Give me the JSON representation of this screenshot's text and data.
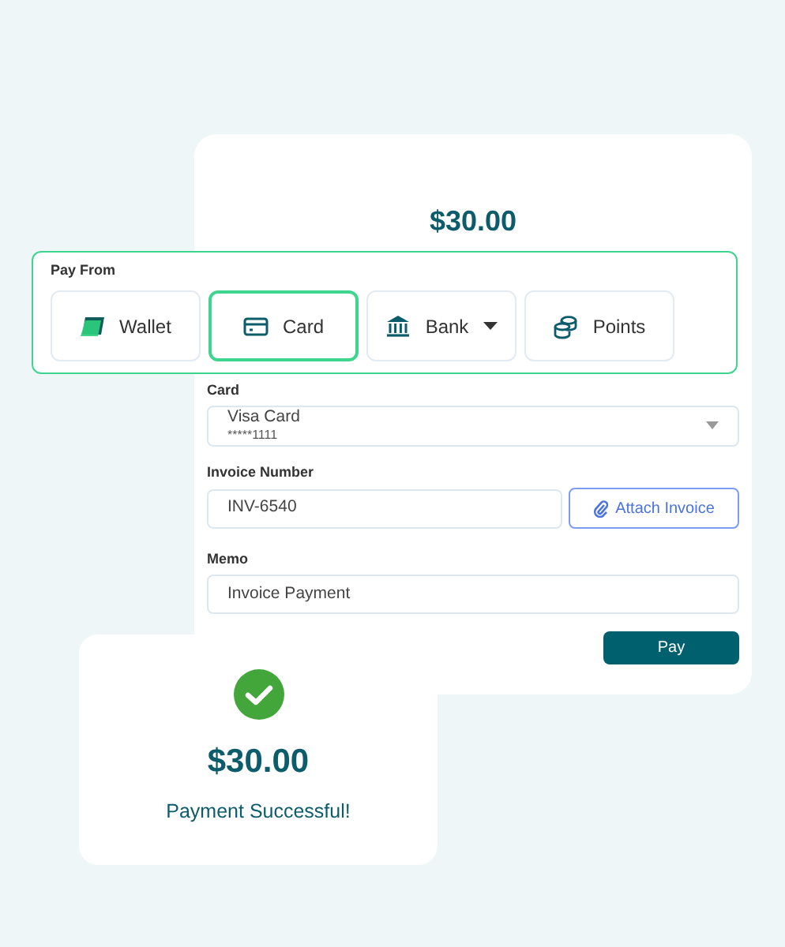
{
  "payment_form": {
    "amount": "$30.00",
    "pay_from": {
      "label": "Pay From",
      "options": [
        {
          "kind": "wallet",
          "label": "Wallet",
          "selected": false,
          "has_menu": false
        },
        {
          "kind": "card",
          "label": "Card",
          "selected": true,
          "has_menu": false
        },
        {
          "kind": "bank",
          "label": "Bank",
          "selected": false,
          "has_menu": true
        },
        {
          "kind": "points",
          "label": "Points",
          "selected": false,
          "has_menu": false
        }
      ]
    },
    "card": {
      "label": "Card",
      "name": "Visa Card",
      "number": "*****1111"
    },
    "invoice": {
      "label": "Invoice Number",
      "value": "INV-6540",
      "attach_button": "Attach Invoice"
    },
    "memo": {
      "label": "Memo",
      "value": "Invoice Payment"
    },
    "pay_button": "Pay"
  },
  "success_card": {
    "amount": "$30.00",
    "message": "Payment Successful!"
  }
}
